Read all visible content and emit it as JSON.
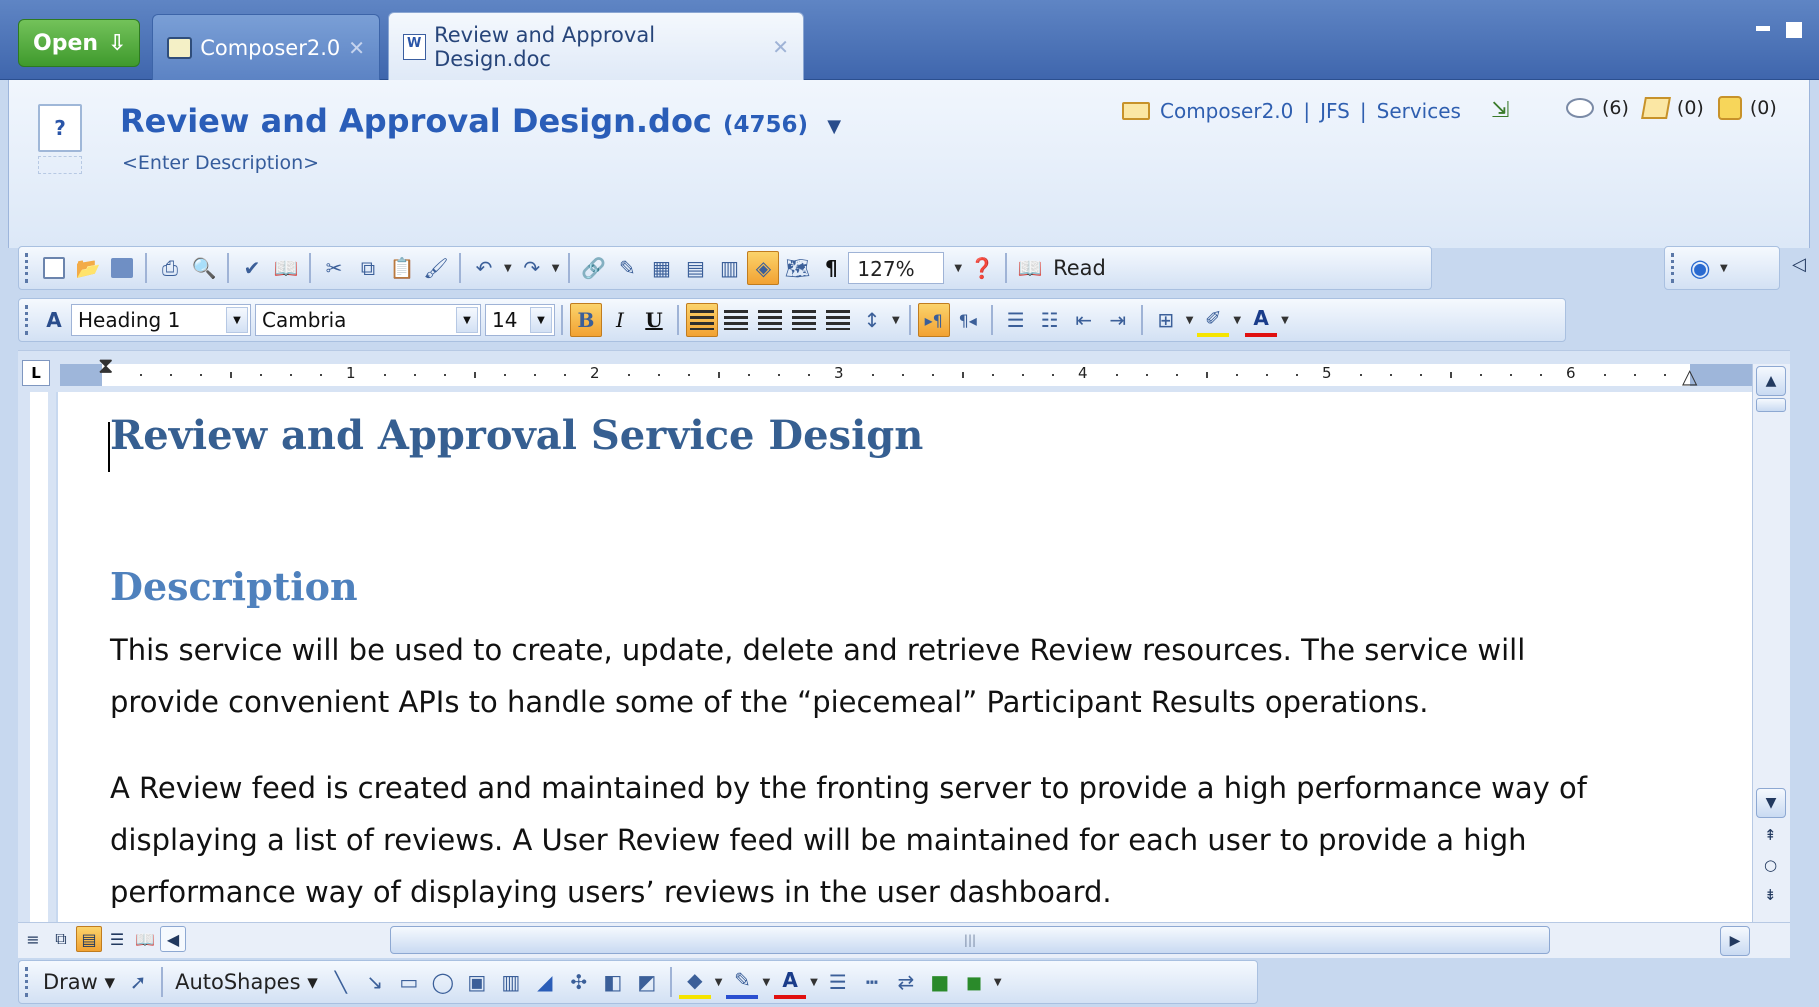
{
  "tabs": {
    "open_label": "Open",
    "composer_label": "Composer2.0",
    "doc_label": "Review and Approval Design.doc"
  },
  "header": {
    "title": "Review and Approval Design.doc",
    "doc_number": "(4756)",
    "description_placeholder": "<Enter Description>",
    "breadcrumb": [
      "Composer2.0",
      "JFS",
      "Services"
    ],
    "comments_count": "(6)",
    "edits_count": "(0)",
    "tasks_count": "(0)"
  },
  "toolbar_standard": {
    "zoom": "127%",
    "read_label": "Read"
  },
  "toolbar_format": {
    "style": "Heading 1",
    "font": "Cambria",
    "size": "14",
    "bold": "B",
    "italic": "I",
    "underline": "U"
  },
  "ruler": {
    "labels": [
      "1",
      "2",
      "3",
      "4",
      "5",
      "6"
    ]
  },
  "document": {
    "title": "Review and Approval Service Design",
    "heading": "Description",
    "paragraph1_line1": "This service will be used to create, update, delete and retrieve Review resources.  The service will",
    "paragraph1_line2": "provide convenient APIs to handle some of the “piecemeal” Participant Results operations.",
    "paragraph2_line1": "A Review feed is created and maintained by the fronting server to provide a high performance way of",
    "paragraph2_line2": "displaying a list of reviews.  A User Review feed will be maintained for each user to provide a high",
    "paragraph2_line3": "performance way of displaying users’ reviews in the user dashboard."
  },
  "drawing_toolbar": {
    "draw_label": "Draw",
    "autoshapes_label": "AutoShapes"
  },
  "colors": {
    "title_blue": "#365f91",
    "heading_blue": "#4f81bd",
    "accent_orange": "#f2a233",
    "open_green": "#3f9a2d"
  }
}
